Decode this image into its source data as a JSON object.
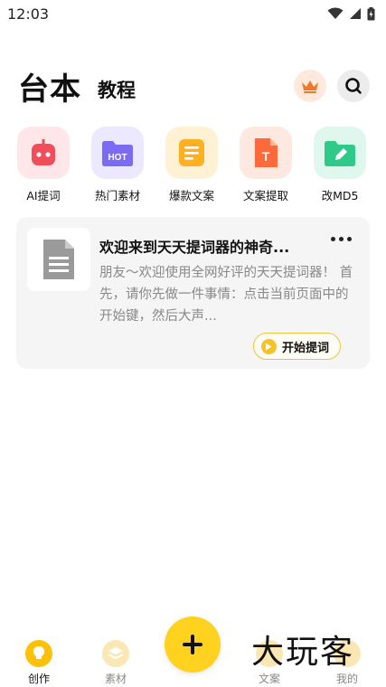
{
  "status_bar": {
    "time": "12:03",
    "icons": [
      "wifi-icon",
      "signal-icon",
      "battery-charging-icon"
    ]
  },
  "header": {
    "title": "台本",
    "subtitle": "教程",
    "actions": [
      "crown-icon",
      "search-icon"
    ]
  },
  "tools": [
    {
      "label": "AI提词",
      "icon": "robot-icon",
      "color": "#f04e5a",
      "bg": "#ffe6e8"
    },
    {
      "label": "热门素材",
      "icon": "hot-folder-icon",
      "color": "#7b6bf2",
      "bg": "#ece8ff",
      "badge": "HOT"
    },
    {
      "label": "爆款文案",
      "icon": "document-lines-icon",
      "color": "#ffb020",
      "bg": "#fff1d4"
    },
    {
      "label": "文案提取",
      "icon": "text-file-icon",
      "color": "#ff6a3d",
      "bg": "#ffe8df",
      "badge": "T"
    },
    {
      "label": "改MD5",
      "icon": "edit-folder-icon",
      "color": "#2fc98a",
      "bg": "#dff7ec"
    }
  ],
  "script_card": {
    "title": "欢迎来到天天提词器的神奇...",
    "preview": "朋友～欢迎使用全网好评的天天提词器！ 首先，请你先做一件事情：点击当前页面中的开始键，然后大声...",
    "start_label": "开始提词"
  },
  "bottom_nav": {
    "items": [
      {
        "label": "创作",
        "icon": "bulb-icon",
        "active": true
      },
      {
        "label": "素材",
        "icon": "layers-icon",
        "active": false
      },
      {
        "label": "文案",
        "icon": "document-icon",
        "active": false
      },
      {
        "label": "我的",
        "icon": "user-icon",
        "active": false
      }
    ],
    "fab_icon": "plus-icon"
  },
  "watermark": "大玩客",
  "colors": {
    "accent": "#ffd21f",
    "card_bg": "#f5f5f5",
    "muted_text": "#888888"
  }
}
